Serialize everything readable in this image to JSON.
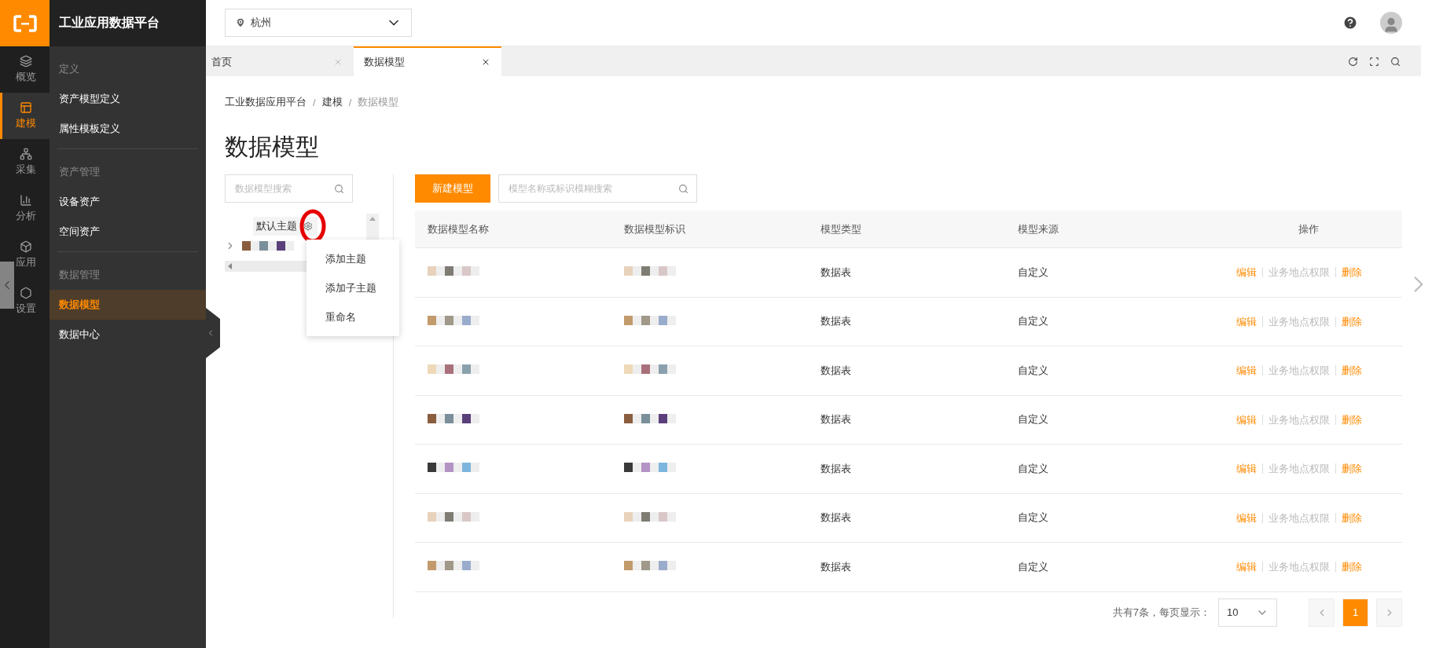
{
  "app_title": "工业应用数据平台",
  "rail": [
    {
      "label": "概览",
      "selected": false
    },
    {
      "label": "建模",
      "selected": true
    },
    {
      "label": "采集",
      "selected": false
    },
    {
      "label": "分析",
      "selected": false
    },
    {
      "label": "应用",
      "selected": false
    },
    {
      "label": "设置",
      "selected": false
    }
  ],
  "menu": [
    {
      "title": "定义",
      "items": [
        {
          "label": "资产模型定义",
          "selected": false
        },
        {
          "label": "属性模板定义",
          "selected": false
        }
      ]
    },
    {
      "title": "资产管理",
      "items": [
        {
          "label": "设备资产",
          "selected": false
        },
        {
          "label": "空间资产",
          "selected": false
        }
      ]
    },
    {
      "title": "数据管理",
      "items": [
        {
          "label": "数据模型",
          "selected": true
        },
        {
          "label": "数据中心",
          "selected": false
        }
      ]
    }
  ],
  "location_select": {
    "value": "杭州"
  },
  "tabs": [
    {
      "label": "首页",
      "selected": false
    },
    {
      "label": "数据模型",
      "selected": true
    }
  ],
  "breadcrumb": [
    {
      "label": "工业数据应用平台"
    },
    {
      "separator": "/",
      "label": "建模"
    },
    {
      "separator": "/",
      "label": "数据模型"
    }
  ],
  "page_title": "数据模型",
  "tree": {
    "search_placeholder": "数据模型搜索",
    "root_label": "默认主题",
    "nodes": [
      {
        "expanded": false
      }
    ]
  },
  "context_menu": [
    "添加主题",
    "添加子主题",
    "重命名"
  ],
  "toolbar": {
    "new_button": "新建模型",
    "search_placeholder": "模型名称或标识模糊搜索"
  },
  "table": {
    "columns": [
      "数据模型名称",
      "数据模型标识",
      "模型类型",
      "模型来源",
      "操作"
    ],
    "rows": [
      {
        "type": "数据表",
        "source": "自定义",
        "actions": [
          {
            "label": "编辑",
            "disabled": false
          },
          {
            "label": "业务地点权限",
            "disabled": true
          },
          {
            "label": "删除",
            "disabled": false
          }
        ]
      },
      {
        "type": "数据表",
        "source": "自定义",
        "actions": [
          {
            "label": "编辑",
            "disabled": false
          },
          {
            "label": "业务地点权限",
            "disabled": true
          },
          {
            "label": "删除",
            "disabled": false
          }
        ]
      },
      {
        "type": "数据表",
        "source": "自定义",
        "actions": [
          {
            "label": "编辑",
            "disabled": false
          },
          {
            "label": "业务地点权限",
            "disabled": true
          },
          {
            "label": "删除",
            "disabled": false
          }
        ]
      },
      {
        "type": "数据表",
        "source": "自定义",
        "actions": [
          {
            "label": "编辑",
            "disabled": false
          },
          {
            "label": "业务地点权限",
            "disabled": true
          },
          {
            "label": "删除",
            "disabled": false
          }
        ]
      },
      {
        "type": "数据表",
        "source": "自定义",
        "actions": [
          {
            "label": "编辑",
            "disabled": false
          },
          {
            "label": "业务地点权限",
            "disabled": true
          },
          {
            "label": "删除",
            "disabled": false
          }
        ]
      },
      {
        "type": "数据表",
        "source": "自定义",
        "actions": [
          {
            "label": "编辑",
            "disabled": false
          },
          {
            "label": "业务地点权限",
            "disabled": true
          },
          {
            "label": "删除",
            "disabled": false
          }
        ]
      },
      {
        "type": "数据表",
        "source": "自定义",
        "actions": [
          {
            "label": "编辑",
            "disabled": false
          },
          {
            "label": "业务地点权限",
            "disabled": true
          },
          {
            "label": "删除",
            "disabled": false
          }
        ]
      }
    ]
  },
  "pagination": {
    "summary": "共有7条，每页显示：",
    "page_size": "10",
    "pages": [
      {
        "label": "1",
        "selected": true
      }
    ]
  }
}
